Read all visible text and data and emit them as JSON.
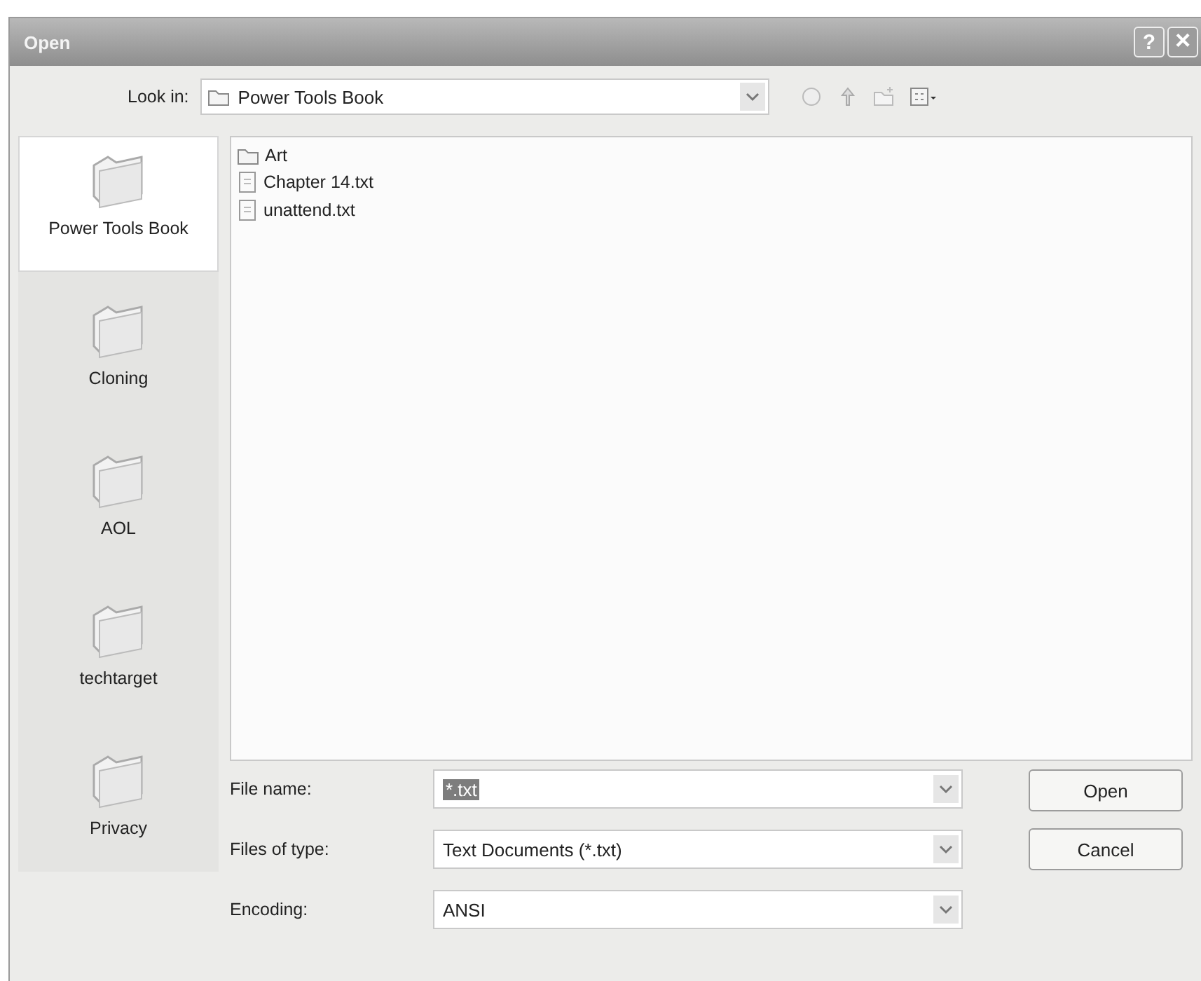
{
  "window": {
    "title": "Open",
    "buttons": [
      {
        "kind": "help",
        "label": "?"
      },
      {
        "kind": "close",
        "label": "×"
      }
    ]
  },
  "look_in": {
    "label": "Look in:",
    "value": "Power Tools Book"
  },
  "toolbar": [
    {
      "kind": "back"
    },
    {
      "kind": "up"
    },
    {
      "kind": "newfolder"
    },
    {
      "kind": "views"
    }
  ],
  "places": [
    {
      "label": "Power Tools Book",
      "selected": true
    },
    {
      "label": "Cloning",
      "selected": false
    },
    {
      "label": "AOL",
      "selected": false
    },
    {
      "label": "techtarget",
      "selected": false
    },
    {
      "label": "Privacy",
      "selected": false
    }
  ],
  "files": [
    {
      "name": "Art",
      "kind": "folder"
    },
    {
      "name": "Chapter 14.txt",
      "kind": "text"
    },
    {
      "name": "unattend.txt",
      "kind": "text"
    }
  ],
  "fields": [
    {
      "label": "File name:",
      "value": "*.txt",
      "selected": true
    },
    {
      "label": "Files of type:",
      "value": "Text Documents (*.txt)",
      "selected": false
    },
    {
      "label": "Encoding:",
      "value": "ANSI",
      "selected": false
    }
  ],
  "buttons": [
    "Open",
    "Cancel"
  ]
}
